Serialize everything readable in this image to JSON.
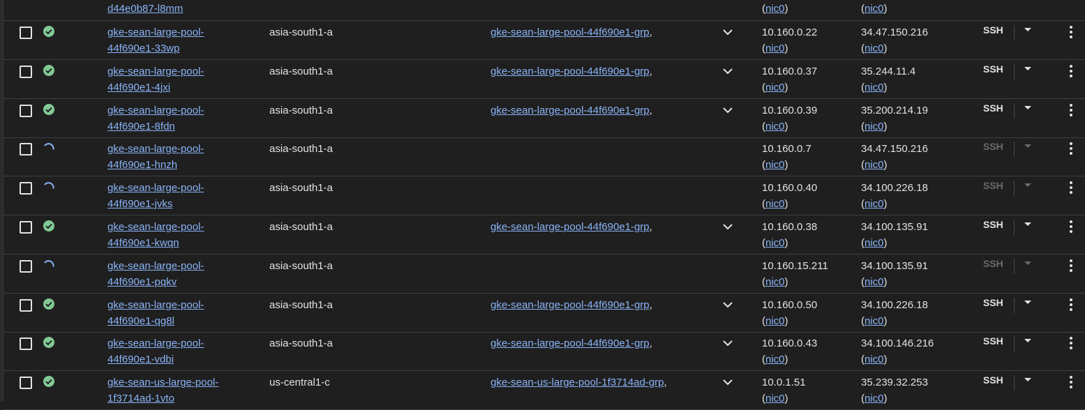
{
  "colors": {
    "link": "#8ab4f8",
    "ok": "#81c995",
    "spinner": "#8ab4f8",
    "text": "#e3e3e3",
    "disabled": "#6b6b6b"
  },
  "partial_row": {
    "name_line2": "d44e0b87-l8mm",
    "internal_nic": "nic0",
    "external_nic": "nic0"
  },
  "rows": [
    {
      "name1": "gke-sean-large-pool-",
      "name2": "44f690e1-33wp",
      "zone": "asia-south1-a",
      "group": "gke-sean-large-pool-44f690e1-grp",
      "internal_ip": "10.160.0.22",
      "external_ip": "34.47.150.216",
      "nic": "nic0",
      "ssh": "SSH",
      "status": "running"
    },
    {
      "name1": "gke-sean-large-pool-",
      "name2": "44f690e1-4jxi",
      "zone": "asia-south1-a",
      "group": "gke-sean-large-pool-44f690e1-grp",
      "internal_ip": "10.160.0.37",
      "external_ip": "35.244.11.4",
      "nic": "nic0",
      "ssh": "SSH",
      "status": "running"
    },
    {
      "name1": "gke-sean-large-pool-",
      "name2": "44f690e1-8fdn",
      "zone": "asia-south1-a",
      "group": "gke-sean-large-pool-44f690e1-grp",
      "internal_ip": "10.160.0.39",
      "external_ip": "35.200.214.19",
      "nic": "nic0",
      "ssh": "SSH",
      "status": "running"
    },
    {
      "name1": "gke-sean-large-pool-",
      "name2": "44f690e1-hnzh",
      "zone": "asia-south1-a",
      "group": "",
      "internal_ip": "10.160.0.7",
      "external_ip": "34.47.150.216",
      "nic": "nic0",
      "ssh": "SSH",
      "status": "pending"
    },
    {
      "name1": "gke-sean-large-pool-",
      "name2": "44f690e1-jvks",
      "zone": "asia-south1-a",
      "group": "",
      "internal_ip": "10.160.0.40",
      "external_ip": "34.100.226.18",
      "nic": "nic0",
      "ssh": "SSH",
      "status": "pending"
    },
    {
      "name1": "gke-sean-large-pool-",
      "name2": "44f690e1-kwqn",
      "zone": "asia-south1-a",
      "group": "gke-sean-large-pool-44f690e1-grp",
      "internal_ip": "10.160.0.38",
      "external_ip": "34.100.135.91",
      "nic": "nic0",
      "ssh": "SSH",
      "status": "running"
    },
    {
      "name1": "gke-sean-large-pool-",
      "name2": "44f690e1-pqkv",
      "zone": "asia-south1-a",
      "group": "",
      "internal_ip": "10.160.15.211",
      "external_ip": "34.100.135.91",
      "nic": "nic0",
      "ssh": "SSH",
      "status": "pending"
    },
    {
      "name1": "gke-sean-large-pool-",
      "name2": "44f690e1-qg8l",
      "zone": "asia-south1-a",
      "group": "gke-sean-large-pool-44f690e1-grp",
      "internal_ip": "10.160.0.50",
      "external_ip": "34.100.226.18",
      "nic": "nic0",
      "ssh": "SSH",
      "status": "running"
    },
    {
      "name1": "gke-sean-large-pool-",
      "name2": "44f690e1-vdbi",
      "zone": "asia-south1-a",
      "group": "gke-sean-large-pool-44f690e1-grp",
      "internal_ip": "10.160.0.43",
      "external_ip": "34.100.146.216",
      "nic": "nic0",
      "ssh": "SSH",
      "status": "running"
    },
    {
      "name1": "gke-sean-us-large-pool-",
      "name2": "1f3714ad-1vto",
      "zone": "us-central1-c",
      "group": "gke-sean-us-large-pool-1f3714ad-grp",
      "internal_ip": "10.0.1.51",
      "external_ip": "35.239.32.253",
      "nic": "nic0",
      "ssh": "SSH",
      "status": "running"
    }
  ]
}
